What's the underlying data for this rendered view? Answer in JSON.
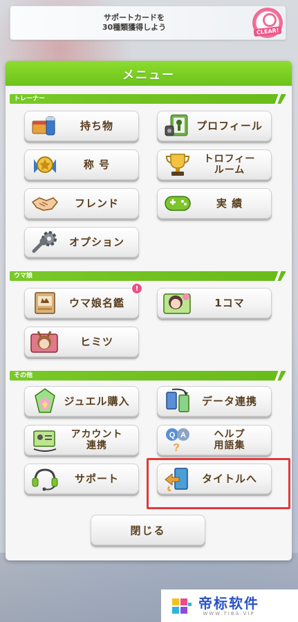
{
  "mission": {
    "line1": "サポートカードを",
    "line2": "30種類獲得しよう",
    "badge": "CLEAR!"
  },
  "menu": {
    "title": "メニュー",
    "sections": {
      "trainer": "トレーナー",
      "umamusume": "ウマ娘",
      "other": "その他"
    },
    "buttons": {
      "inventory": "持ち物",
      "profile": "プロフィール",
      "title": "称 号",
      "trophy_line1": "トロフィー",
      "trophy_line2": "ルーム",
      "friend": "フレンド",
      "achievement": "実 績",
      "option": "オプション",
      "directory": "ウマ娘名鑑",
      "directory_badge": "!",
      "one_koma": "1コマ",
      "himitsu": "ヒミツ",
      "jewel": "ジュエル購入",
      "data_link": "データ連携",
      "account_line1": "アカウント",
      "account_line2": "連携",
      "help_line1": "ヘルプ",
      "help_line2": "用語集",
      "support": "サポート",
      "to_title": "タイトルへ",
      "close": "閉じる"
    }
  },
  "watermark": {
    "title": "帝标软件",
    "sub": "WWW.TIBA.VIP"
  },
  "colors": {
    "accent_green": "#6cc31b",
    "label_brown": "#5a3e1f",
    "highlight_red": "#e0393c",
    "badge_pink": "#ee4f86"
  }
}
